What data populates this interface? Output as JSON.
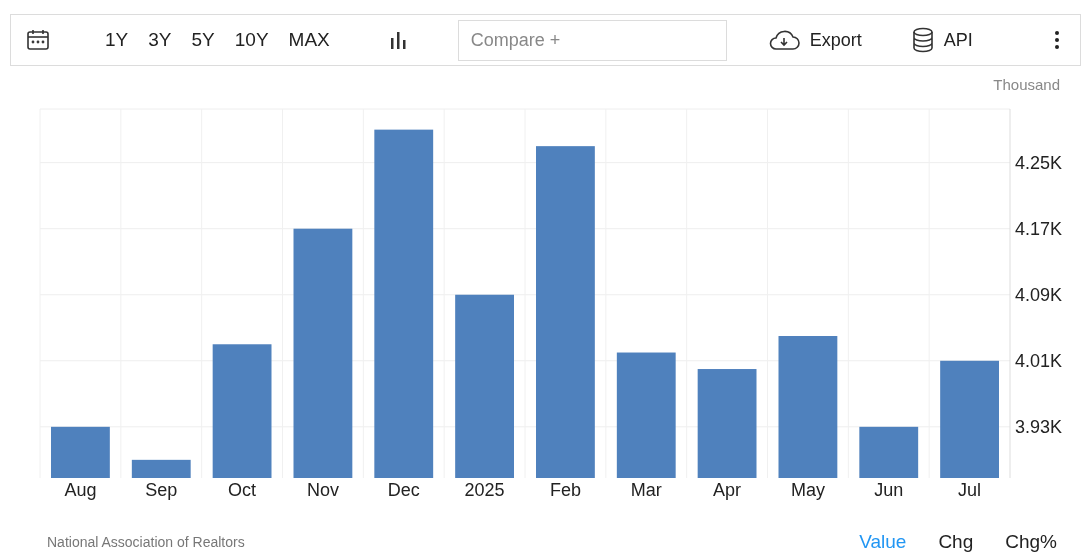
{
  "toolbar": {
    "ranges": [
      "1Y",
      "3Y",
      "5Y",
      "10Y",
      "MAX"
    ],
    "compare": {
      "placeholder": "Compare +"
    },
    "export": "Export",
    "api": "API"
  },
  "chart": {
    "unit": "Thousand",
    "chart_data": {
      "type": "bar",
      "categories": [
        "Aug",
        "Sep",
        "Oct",
        "Nov",
        "Dec",
        "2025",
        "Feb",
        "Mar",
        "Apr",
        "May",
        "Jun",
        "Jul"
      ],
      "grid": true,
      "series": [
        {
          "color": "#4f81bd",
          "values": [
            3.93,
            3.89,
            4.03,
            4.17,
            4.29,
            4.09,
            4.27,
            4.02,
            4.0,
            4.04,
            3.93,
            4.01
          ]
        }
      ],
      "ylim": [
        3.868,
        4.315
      ],
      "yticks": [
        {
          "value": 3.93,
          "label": "3.93K"
        },
        {
          "value": 4.01,
          "label": "4.01K"
        },
        {
          "value": 4.09,
          "label": "4.09K"
        },
        {
          "value": 4.17,
          "label": "4.17K"
        },
        {
          "value": 4.25,
          "label": "4.25K"
        }
      ]
    }
  },
  "footer": {
    "source": "National Association of Realtors",
    "views": [
      {
        "label": "Value",
        "selected": true
      },
      {
        "label": "Chg",
        "selected": false
      },
      {
        "label": "Chg%",
        "selected": false
      }
    ]
  }
}
